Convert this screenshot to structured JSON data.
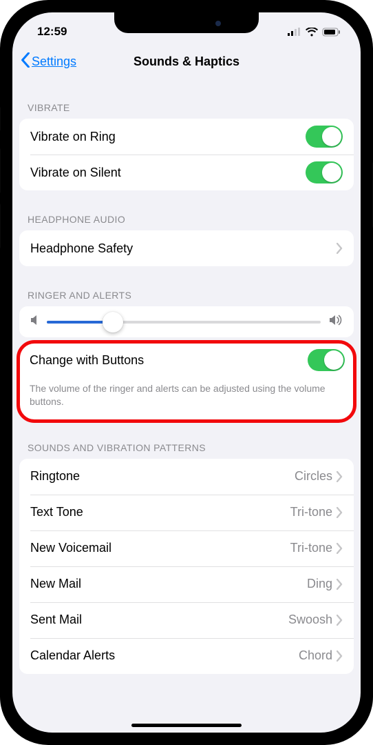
{
  "status": {
    "time": "12:59"
  },
  "nav": {
    "back": "Settings",
    "title": "Sounds & Haptics"
  },
  "sections": {
    "vibrate": {
      "header": "VIBRATE",
      "ring": "Vibrate on Ring",
      "silent": "Vibrate on Silent"
    },
    "headphone": {
      "header": "HEADPHONE AUDIO",
      "safety": "Headphone Safety"
    },
    "ringer": {
      "header": "RINGER AND ALERTS",
      "changeWithButtons": "Change with Buttons",
      "footer": "The volume of the ringer and alerts can be adjusted using the volume buttons.",
      "sliderPercent": 24
    },
    "sounds": {
      "header": "SOUNDS AND VIBRATION PATTERNS",
      "items": [
        {
          "label": "Ringtone",
          "value": "Circles"
        },
        {
          "label": "Text Tone",
          "value": "Tri-tone"
        },
        {
          "label": "New Voicemail",
          "value": "Tri-tone"
        },
        {
          "label": "New Mail",
          "value": "Ding"
        },
        {
          "label": "Sent Mail",
          "value": "Swoosh"
        },
        {
          "label": "Calendar Alerts",
          "value": "Chord"
        }
      ]
    }
  },
  "toggles": {
    "vibrateRing": true,
    "vibrateSilent": true,
    "changeWithButtons": true
  }
}
